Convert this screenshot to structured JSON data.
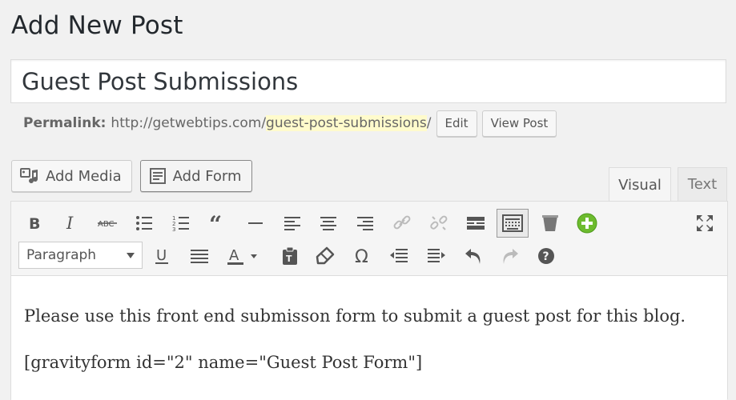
{
  "page": {
    "title": "Add New Post"
  },
  "post": {
    "title": "Guest Post Submissions",
    "permalink": {
      "label": "Permalink:",
      "base": "http://getwebtips.com/",
      "slug": "guest-post-submissions",
      "trailing": "/",
      "edit_label": "Edit",
      "view_label": "View Post"
    }
  },
  "media_buttons": {
    "add_media": "Add Media",
    "add_form": "Add Form"
  },
  "tabs": {
    "visual": "Visual",
    "text": "Text"
  },
  "toolbar": {
    "format_select": "Paragraph",
    "row1": [
      "bold-icon",
      "italic-icon",
      "strikethrough-icon",
      "bullet-list-icon",
      "numbered-list-icon",
      "blockquote-icon",
      "horizontal-rule-icon",
      "align-left-icon",
      "align-center-icon",
      "align-right-icon",
      "link-icon",
      "unlink-icon",
      "read-more-icon",
      "toolbar-toggle-icon",
      "trash-icon",
      "add-icon",
      "fullscreen-icon"
    ],
    "row2": [
      "underline-icon",
      "justify-icon",
      "text-color-icon",
      "paste-text-icon",
      "clear-formatting-icon",
      "special-character-icon",
      "outdent-icon",
      "indent-icon",
      "undo-icon",
      "redo-icon",
      "help-icon"
    ],
    "accent_green": "#7ad03a"
  },
  "content": {
    "paragraphs": [
      "Please use this front end submisson form to submit a guest post for this blog.",
      "[gravityform id=\"2\" name=\"Guest Post Form\"]"
    ]
  }
}
